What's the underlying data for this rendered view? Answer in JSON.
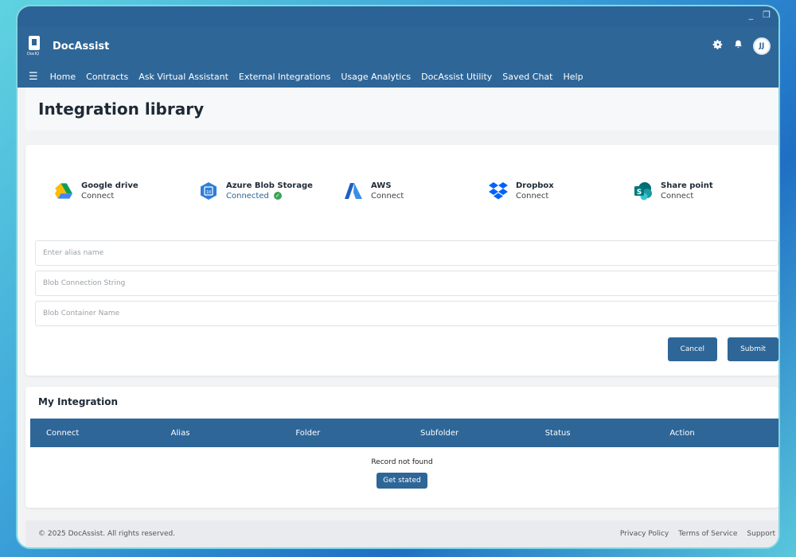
{
  "window": {
    "minimize": "_",
    "restore": "❐"
  },
  "header": {
    "app_name": "DocAssist",
    "logo_tag": "DocIQ",
    "avatar_initials": "JJ",
    "settings_icon": "gear-icon",
    "bell_icon": "bell-icon"
  },
  "nav": {
    "menu_icon": "☰",
    "items": [
      "Home",
      "Contracts",
      "Ask Virtual Assistant",
      "External Integrations",
      "Usage Analytics",
      "DocAssist Utility",
      "Saved Chat",
      "Help"
    ]
  },
  "page": {
    "title": "Integration library"
  },
  "providers": [
    {
      "name": "Google drive",
      "status": "Connect",
      "icon": "google-drive-icon"
    },
    {
      "name": "Azure Blob Storage",
      "status": "Connected",
      "icon": "azure-blob-icon"
    },
    {
      "name": "AWS",
      "status": "Connect",
      "icon": "aws-icon"
    },
    {
      "name": "Dropbox",
      "status": "Connect",
      "icon": "dropbox-icon"
    },
    {
      "name": "Share point",
      "status": "Connect",
      "icon": "sharepoint-icon"
    }
  ],
  "form": {
    "alias_placeholder": "Enter alias name",
    "connection_placeholder": "Blob Connection String",
    "container_placeholder": "Blob Container Name",
    "cancel_label": "Cancel",
    "submit_label": "Submit"
  },
  "integrations": {
    "title": "My Integration",
    "columns": [
      "Connect",
      "Alias",
      "Folder",
      "Subfolder",
      "Status",
      "Action"
    ],
    "empty_text": "Record not found",
    "get_started_label": "Get stated"
  },
  "footer": {
    "copyright": "© 2025 DocAssist. All rights reserved.",
    "links": [
      "Privacy Policy",
      "Terms of Service",
      "Support"
    ]
  },
  "colors": {
    "primary": "#2e6698",
    "success": "#3aa655"
  }
}
